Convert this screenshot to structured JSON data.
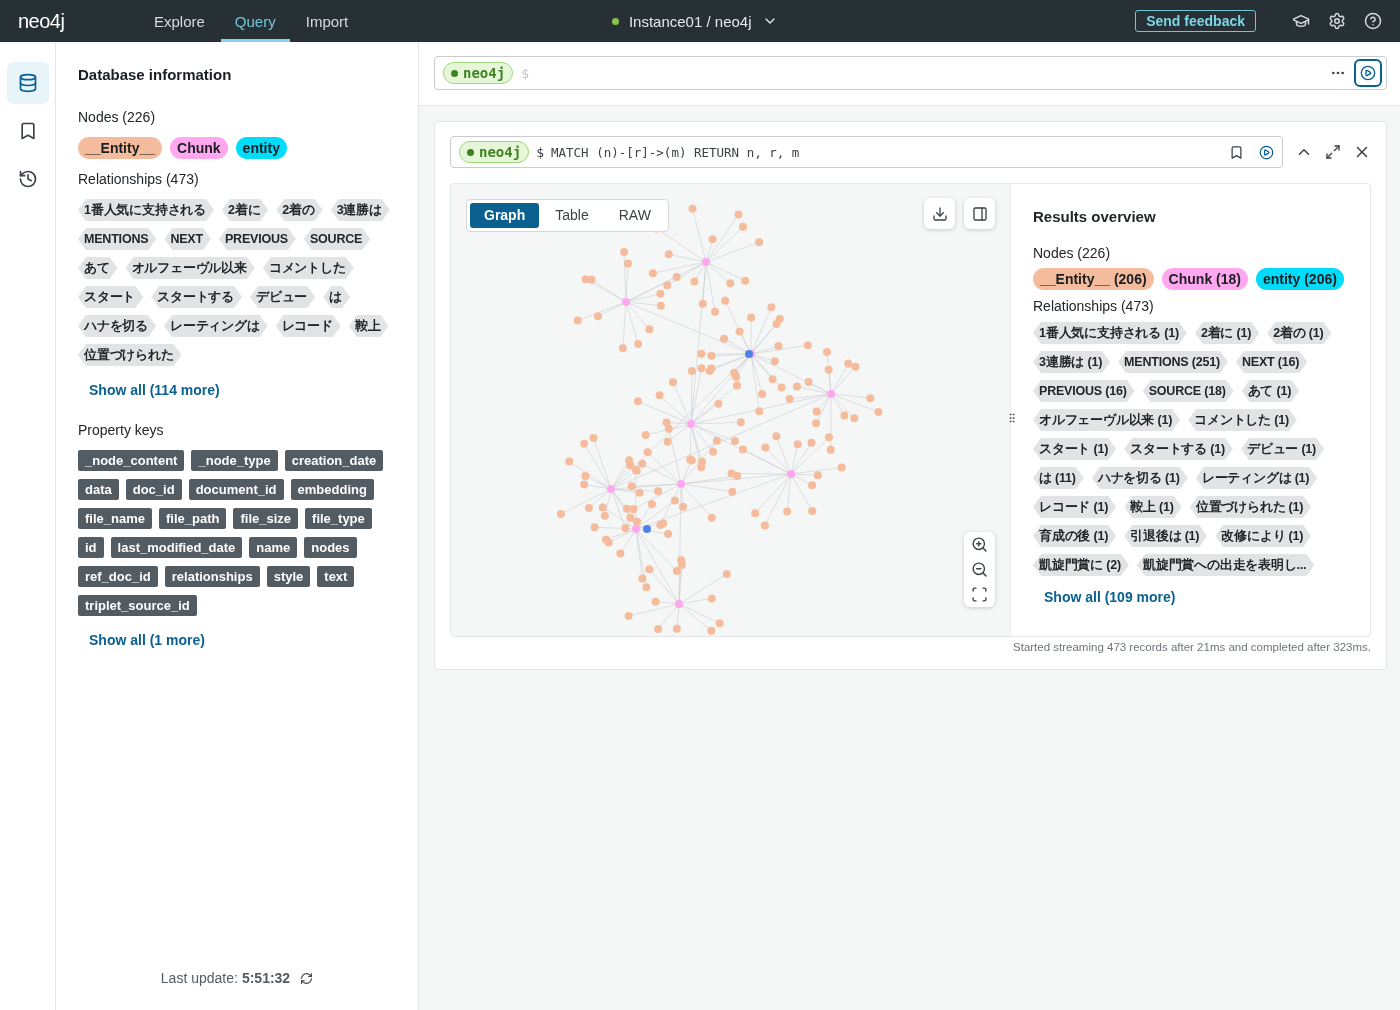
{
  "nav": {
    "logo": "neo4j",
    "tabs": [
      {
        "label": "Explore",
        "selected": false
      },
      {
        "label": "Query",
        "selected": true
      },
      {
        "label": "Import",
        "selected": false
      }
    ],
    "instance": {
      "label": "Instance01 / neo4j",
      "connected": true
    },
    "feedback": "Send feedback"
  },
  "rail": [
    {
      "kind": "database",
      "selected": true
    },
    {
      "kind": "saved",
      "selected": false
    },
    {
      "kind": "history",
      "selected": false
    }
  ],
  "sidebar": {
    "title": "Database information",
    "nodes_heading": "Nodes (226)",
    "node_labels": [
      {
        "label": "__Entity__",
        "color": "#f4bc9c"
      },
      {
        "label": "Chunk",
        "color": "#ffa8f0"
      },
      {
        "label": "entity",
        "color": "#00dcfa"
      }
    ],
    "relationships_heading": "Relationships (473)",
    "relationship_types": [
      "1番人気に支持される",
      "2着に",
      "2着の",
      "3連勝は",
      "MENTIONS",
      "NEXT",
      "PREVIOUS",
      "SOURCE",
      "あて",
      "オルフェーヴル以来",
      "コメントした",
      "スタート",
      "スタートする",
      "デビュー",
      "は",
      "ハナを切る",
      "レーティングは",
      "レコード",
      "鞍上",
      "位置づけられた"
    ],
    "relationships_more": "Show all (114 more)",
    "property_heading": "Property keys",
    "property_keys": [
      "_node_content",
      "_node_type",
      "creation_date",
      "data",
      "doc_id",
      "document_id",
      "embedding",
      "file_name",
      "file_path",
      "file_size",
      "file_type",
      "id",
      "last_modified_date",
      "name",
      "nodes",
      "ref_doc_id",
      "relationships",
      "style",
      "text",
      "triplet_source_id"
    ],
    "property_more": "Show all (1 more)",
    "last_update_label": "Last update:",
    "last_update_time": "5:51:32"
  },
  "editor": {
    "database": "neo4j",
    "prompt": "$"
  },
  "result": {
    "database": "neo4j",
    "prompt": "$",
    "query": "MATCH (n)-[r]->(m) RETURN n, r, m",
    "views": [
      {
        "label": "Graph",
        "selected": true
      },
      {
        "label": "Table",
        "selected": false
      },
      {
        "label": "RAW",
        "selected": false
      }
    ],
    "overview": {
      "title": "Results overview",
      "nodes_heading": "Nodes (226)",
      "node_labels": [
        {
          "label": "__Entity__ (206)",
          "color": "#f4bc9c"
        },
        {
          "label": "Chunk (18)",
          "color": "#ffa8f0"
        },
        {
          "label": "entity (206)",
          "color": "#00dcfa"
        }
      ],
      "relationships_heading": "Relationships (473)",
      "relationship_types": [
        "1番人気に支持される (1)",
        "2着に (1)",
        "2着の (1)",
        "3連勝は (1)",
        "MENTIONS (251)",
        "NEXT (16)",
        "PREVIOUS (16)",
        "SOURCE (18)",
        "あて (1)",
        "オルフェーヴル以来 (1)",
        "コメントした (1)",
        "スタート (1)",
        "スタートする (1)",
        "デビュー (1)",
        "は (11)",
        "ハナを切る (1)",
        "レーティングは (1)",
        "レコード (1)",
        "鞍上 (1)",
        "位置づけられた (1)",
        "育成の後 (1)",
        "引退後は (1)",
        "改修により (1)",
        "凱旋門賞に (2)",
        "凱旋門賞への出走を表明し..."
      ],
      "relationships_more": "Show all (109 more)"
    },
    "status": "Started streaming 473 records after 21ms and completed after 323ms."
  }
}
